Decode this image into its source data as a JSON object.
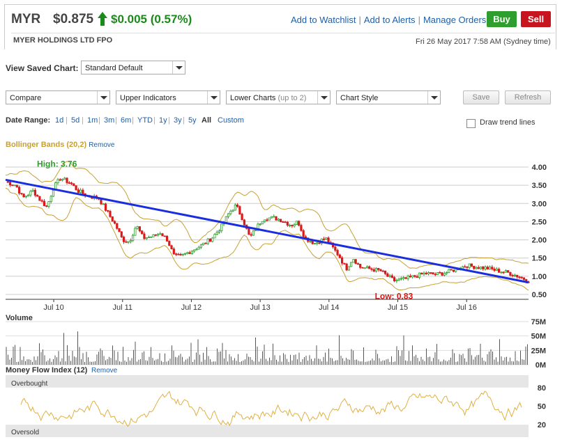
{
  "header": {
    "ticker": "MYR",
    "price": "$0.875",
    "change": "$0.005 (0.57%)",
    "company": "MYER HOLDINGS LTD FPO",
    "datetime": "Fri 26 May 2017 7:58 AM (Sydney time)",
    "links": [
      "Add to Watchlist",
      "Add to Alerts",
      "Manage Orders"
    ],
    "buy_label": "Buy",
    "sell_label": "Sell",
    "up_color": "#1a8a1a",
    "buy_color": "#2e9e2e",
    "sell_color": "#c8141e"
  },
  "controls": {
    "view_saved_label": "View Saved Chart:",
    "saved_chart": "Standard Default",
    "compare": "Compare",
    "upper_indicators": "Upper Indicators",
    "lower_charts": "Lower Charts",
    "lower_charts_hint": "(up to 2)",
    "chart_style": "Chart Style",
    "save_label": "Save",
    "refresh_label": "Refresh",
    "date_range_label": "Date Range:",
    "date_ranges": [
      "1d",
      "5d",
      "1m",
      "3m",
      "6m",
      "YTD",
      "1y",
      "3y",
      "5y",
      "All",
      "Custom"
    ],
    "selected_range": "All",
    "draw_trend_label": "Draw trend lines"
  },
  "indicator": {
    "name": "Bollinger Bands (20,2)",
    "remove_label": "Remove",
    "color": "#c8a030"
  },
  "chart_data": [
    {
      "type": "candlestick",
      "x_ticks": [
        "Jul 10",
        "Jul 11",
        "Jul 12",
        "Jul 13",
        "Jul 14",
        "Jul 15",
        "Jul 16"
      ],
      "x_tick_years": [
        2010.5,
        2011.5,
        2012.5,
        2013.5,
        2014.5,
        2015.5,
        2016.5
      ],
      "x_range": [
        2009.8,
        2017.4
      ],
      "y_ticks": [
        "4.00",
        "3.50",
        "3.00",
        "2.50",
        "2.00",
        "1.50",
        "1.00",
        "0.50"
      ],
      "ylim": [
        0.5,
        4.0
      ],
      "grid": true,
      "high_label": "High: 3.76",
      "high_point": [
        2010.52,
        3.76
      ],
      "low_label": "Low: 0.83",
      "low_point": [
        2015.45,
        0.83
      ],
      "trend_line": [
        [
          2009.8,
          3.65
        ],
        [
          2017.4,
          0.83
        ]
      ],
      "price_path": [
        [
          2009.8,
          3.6
        ],
        [
          2009.95,
          3.5
        ],
        [
          2010.05,
          3.15
        ],
        [
          2010.2,
          3.35
        ],
        [
          2010.3,
          3.1
        ],
        [
          2010.4,
          2.9
        ],
        [
          2010.5,
          3.45
        ],
        [
          2010.6,
          3.7
        ],
        [
          2010.75,
          3.55
        ],
        [
          2010.85,
          3.35
        ],
        [
          2011.0,
          3.2
        ],
        [
          2011.15,
          3.15
        ],
        [
          2011.25,
          2.85
        ],
        [
          2011.4,
          2.4
        ],
        [
          2011.5,
          2.0
        ],
        [
          2011.6,
          1.95
        ],
        [
          2011.7,
          2.4
        ],
        [
          2011.8,
          2.05
        ],
        [
          2011.95,
          2.1
        ],
        [
          2012.05,
          2.2
        ],
        [
          2012.15,
          2.0
        ],
        [
          2012.25,
          1.55
        ],
        [
          2012.35,
          1.55
        ],
        [
          2012.5,
          1.7
        ],
        [
          2012.65,
          1.85
        ],
        [
          2012.8,
          2.05
        ],
        [
          2012.95,
          2.4
        ],
        [
          2013.05,
          2.75
        ],
        [
          2013.15,
          2.95
        ],
        [
          2013.25,
          2.55
        ],
        [
          2013.35,
          2.05
        ],
        [
          2013.45,
          2.35
        ],
        [
          2013.55,
          2.6
        ],
        [
          2013.7,
          2.6
        ],
        [
          2013.8,
          2.55
        ],
        [
          2013.95,
          2.4
        ],
        [
          2014.05,
          2.5
        ],
        [
          2014.15,
          2.05
        ],
        [
          2014.3,
          1.9
        ],
        [
          2014.45,
          2.05
        ],
        [
          2014.55,
          1.8
        ],
        [
          2014.65,
          1.55
        ],
        [
          2014.75,
          1.2
        ],
        [
          2014.85,
          1.5
        ],
        [
          2014.95,
          1.25
        ],
        [
          2015.1,
          1.2
        ],
        [
          2015.25,
          1.15
        ],
        [
          2015.35,
          1.0
        ],
        [
          2015.45,
          0.88
        ],
        [
          2015.6,
          0.92
        ],
        [
          2015.75,
          1.0
        ],
        [
          2015.9,
          1.08
        ],
        [
          2016.05,
          1.05
        ],
        [
          2016.2,
          1.1
        ],
        [
          2016.35,
          1.2
        ],
        [
          2016.5,
          1.3
        ],
        [
          2016.65,
          1.25
        ],
        [
          2016.8,
          1.22
        ],
        [
          2016.95,
          1.15
        ],
        [
          2017.1,
          1.1
        ],
        [
          2017.25,
          1.0
        ],
        [
          2017.4,
          0.875
        ]
      ]
    },
    {
      "type": "bar",
      "title": "Volume",
      "y_ticks": [
        "75M",
        "50M",
        "25M",
        "0M"
      ],
      "ylim": [
        0,
        75
      ],
      "unit": "M"
    },
    {
      "type": "line",
      "title": "Money Flow Index (12)",
      "remove_label": "Remove",
      "y_ticks": [
        "80",
        "50",
        "20"
      ],
      "ylim": [
        0,
        100
      ],
      "overbought_label": "Overbought",
      "oversold_label": "Oversold",
      "overbought_level": 80,
      "oversold_level": 20
    }
  ],
  "colors": {
    "up": "#2e9e2e",
    "down": "#d81a1a",
    "trend": "#1a2ee0",
    "bands": "#c8a030",
    "mfi": "#e0b040",
    "volume": "#555555",
    "high_label": "#2e9e2e",
    "low_label": "#d81a1a"
  }
}
